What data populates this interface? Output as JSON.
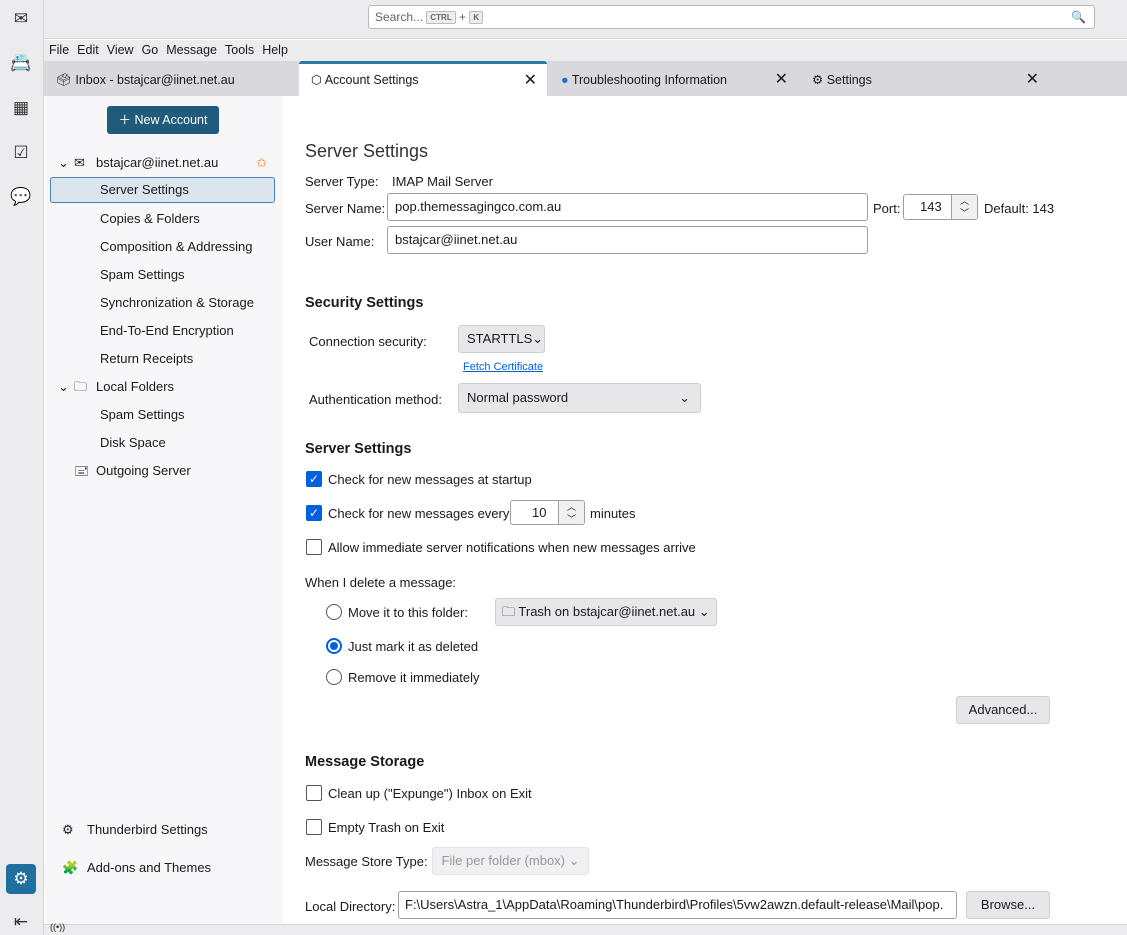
{
  "rail": {
    "icons": [
      "mail-icon",
      "address-book-icon",
      "calendar-icon",
      "tasks-icon",
      "chat-icon",
      "settings-icon",
      "collapse-icon"
    ]
  },
  "search": {
    "placeholder": "Search...",
    "kbd1": "CTRL",
    "plus": "+",
    "kbd2": "K"
  },
  "menu": [
    "File",
    "Edit",
    "View",
    "Go",
    "Message",
    "Tools",
    "Help"
  ],
  "tabs": [
    {
      "label": "Inbox - bstajcar@iinet.net.au"
    },
    {
      "label": "Account Settings"
    },
    {
      "label": "Troubleshooting Information"
    },
    {
      "label": "Settings"
    }
  ],
  "sidebar": {
    "new_account": "New Account",
    "account": "bstajcar@iinet.net.au",
    "account_items": [
      "Server Settings",
      "Copies & Folders",
      "Composition & Addressing",
      "Spam Settings",
      "Synchronization & Storage",
      "End-To-End Encryption",
      "Return Receipts"
    ],
    "local_folders": "Local Folders",
    "local_items": [
      "Spam Settings",
      "Disk Space"
    ],
    "outgoing": "Outgoing Server",
    "tb_settings": "Thunderbird Settings",
    "addons": "Add-ons and Themes"
  },
  "main": {
    "title": "Server Settings",
    "server_type_label": "Server Type:",
    "server_type": "IMAP Mail Server",
    "server_name_label": "Server Name:",
    "server_name": "pop.themessagingco.com.au",
    "port_label": "Port:",
    "port": "143",
    "default_port": "Default: 143",
    "user_name_label": "User Name:",
    "user_name": "bstajcar@iinet.net.au",
    "security_heading": "Security Settings",
    "conn_sec_label": "Connection security:",
    "conn_sec": "STARTTLS",
    "fetch_cert": "Fetch Certificate",
    "auth_label": "Authentication method:",
    "auth": "Normal password",
    "server_heading": "Server Settings",
    "check_startup": "Check for new messages at startup",
    "check_every": "Check for new messages every",
    "minutes_value": "10",
    "minutes": "minutes",
    "allow_notif": "Allow immediate server notifications when new messages arrive",
    "delete_label": "When I delete a message:",
    "move_folder": "Move it to this folder:",
    "trash_folder": "Trash on bstajcar@iinet.net.au",
    "mark_deleted": "Just mark it as deleted",
    "remove_imm": "Remove it immediately",
    "advanced": "Advanced...",
    "storage_heading": "Message Storage",
    "expunge": "Clean up (\"Expunge\") Inbox on Exit",
    "empty_trash": "Empty Trash on Exit",
    "store_type_label": "Message Store Type:",
    "store_type": "File per folder (mbox)",
    "local_dir_label": "Local Directory:",
    "local_dir": "F:\\Users\\Astra_1\\AppData\\Roaming\\Thunderbird\\Profiles\\5vw2awzn.default-release\\Mail\\pop.",
    "browse": "Browse..."
  }
}
